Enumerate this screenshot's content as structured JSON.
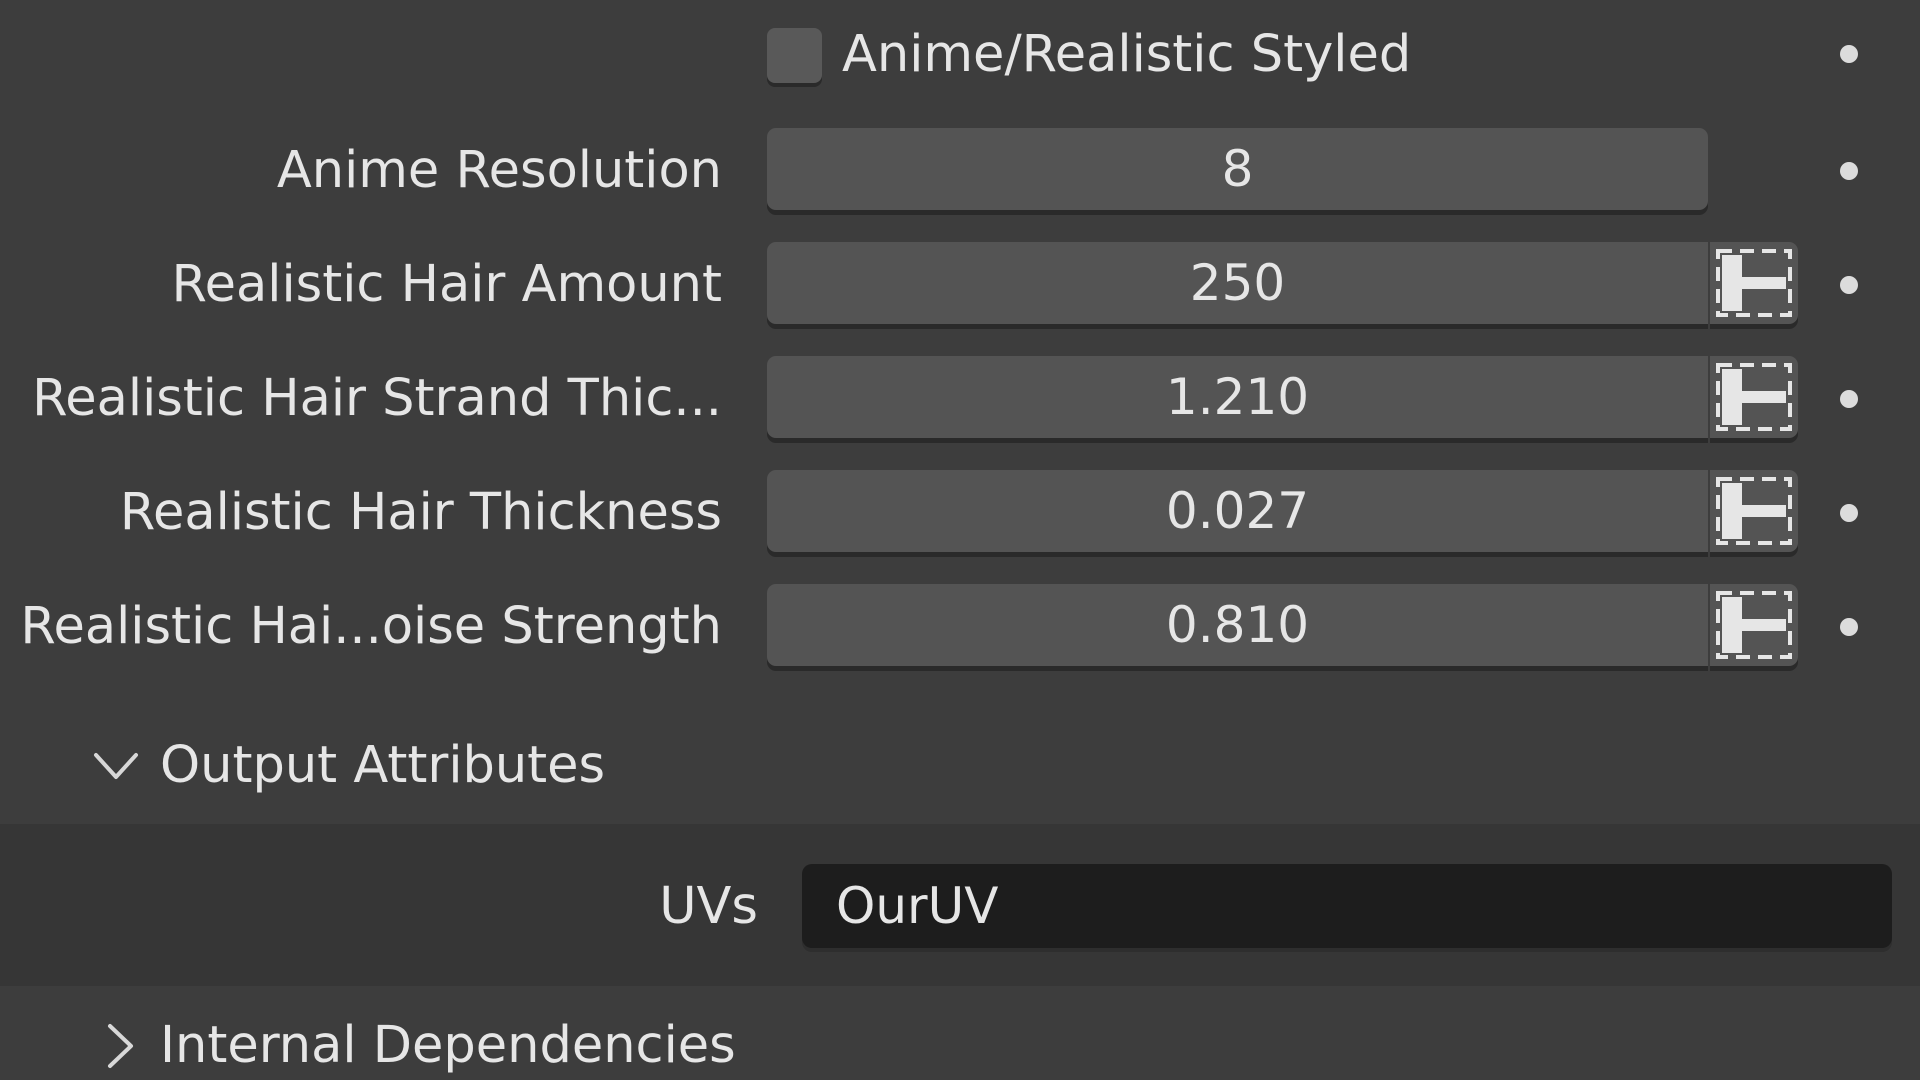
{
  "checkbox": {
    "label": "Anime/Realistic Styled",
    "checked": false
  },
  "properties": [
    {
      "label": "Anime Resolution",
      "value": "8",
      "has_driver_button": false
    },
    {
      "label": "Realistic Hair Amount",
      "value": "250",
      "has_driver_button": true
    },
    {
      "label": "Realistic Hair Strand Thic...",
      "value": "1.210",
      "has_driver_button": true
    },
    {
      "label": "Realistic Hair Thickness",
      "value": "0.027",
      "has_driver_button": true
    },
    {
      "label": "Realistic Hai...oise Strength",
      "value": "0.810",
      "has_driver_button": true
    }
  ],
  "output_attributes": {
    "title": "Output Attributes",
    "expanded": true,
    "uvs_label": "UVs",
    "uvs_value": "OurUV"
  },
  "internal_dependencies": {
    "title": "Internal Dependencies",
    "expanded": false
  },
  "icons": {
    "keyframe": "keyframe-dot-icon",
    "driver": "attribute-toggle-icon",
    "expand": "chevron-down-icon",
    "collapse": "chevron-right-icon"
  },
  "colors": {
    "background": "#3d3d3d",
    "field": "#545454",
    "text_field": "#1d1d1d",
    "text": "#e6e6e6"
  }
}
